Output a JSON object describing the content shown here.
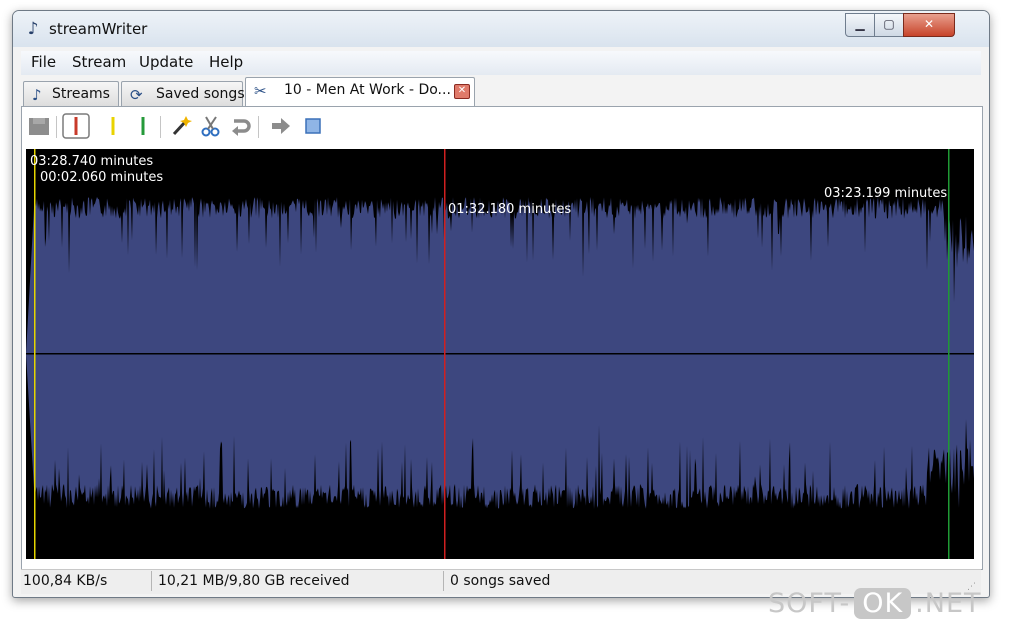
{
  "window": {
    "title": "streamWriter",
    "min_glyph": "▁",
    "max_glyph": "▢",
    "close_glyph": "✕"
  },
  "menu": {
    "items": [
      "File",
      "Stream",
      "Update",
      "Help"
    ]
  },
  "tabs": [
    {
      "label": "Streams",
      "icon": "music-note-icon"
    },
    {
      "label": "Saved songs",
      "icon": "saved-songs-icon"
    },
    {
      "label": "10 - Men At Work - Do...",
      "icon": "cut-icon",
      "close_glyph": "✕"
    }
  ],
  "toolbar": {
    "icons": [
      "save-icon",
      "set-start-marker-icon",
      "yellow-marker-icon",
      "green-marker-icon",
      "auto-detect-icon",
      "cut-icon",
      "undo-icon",
      "play-icon",
      "stop-icon"
    ]
  },
  "waveform": {
    "label_total": "03:28.740 minutes",
    "label_start": "00:02.060 minutes",
    "label_cursor": "01:32.180 minutes",
    "label_end": "03:23.199 minutes",
    "colors": {
      "wave": "#3d477f",
      "background": "#000000",
      "start_line": "#e5d500",
      "cursor_line": "#d02020",
      "end_line": "#1f9a35"
    }
  },
  "status": {
    "speed": "100,84 KB/s",
    "received": "10,21 MB/9,80 GB received",
    "saved": "0 songs saved"
  },
  "watermark": {
    "left": "SOFT-",
    "middle": "OK",
    "right": ".NET"
  }
}
